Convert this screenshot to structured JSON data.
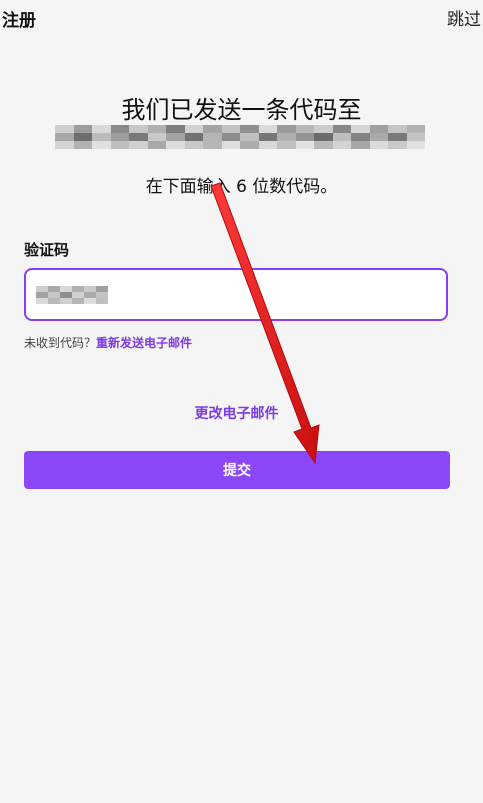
{
  "header": {
    "title": "注册",
    "skip_label": "跳过"
  },
  "main": {
    "headline": "我们已发送一条代码至",
    "subline": "在下面输入 6 位数代码。",
    "code_label": "验证码",
    "resend_prefix": "未收到代码？",
    "resend_link": "重新发送电子邮件",
    "change_email": "更改电子邮件",
    "submit_label": "提交"
  },
  "colors": {
    "accent": "#8b47f5",
    "link": "#7c3ae8",
    "annotation_arrow": "#e31b1b"
  }
}
